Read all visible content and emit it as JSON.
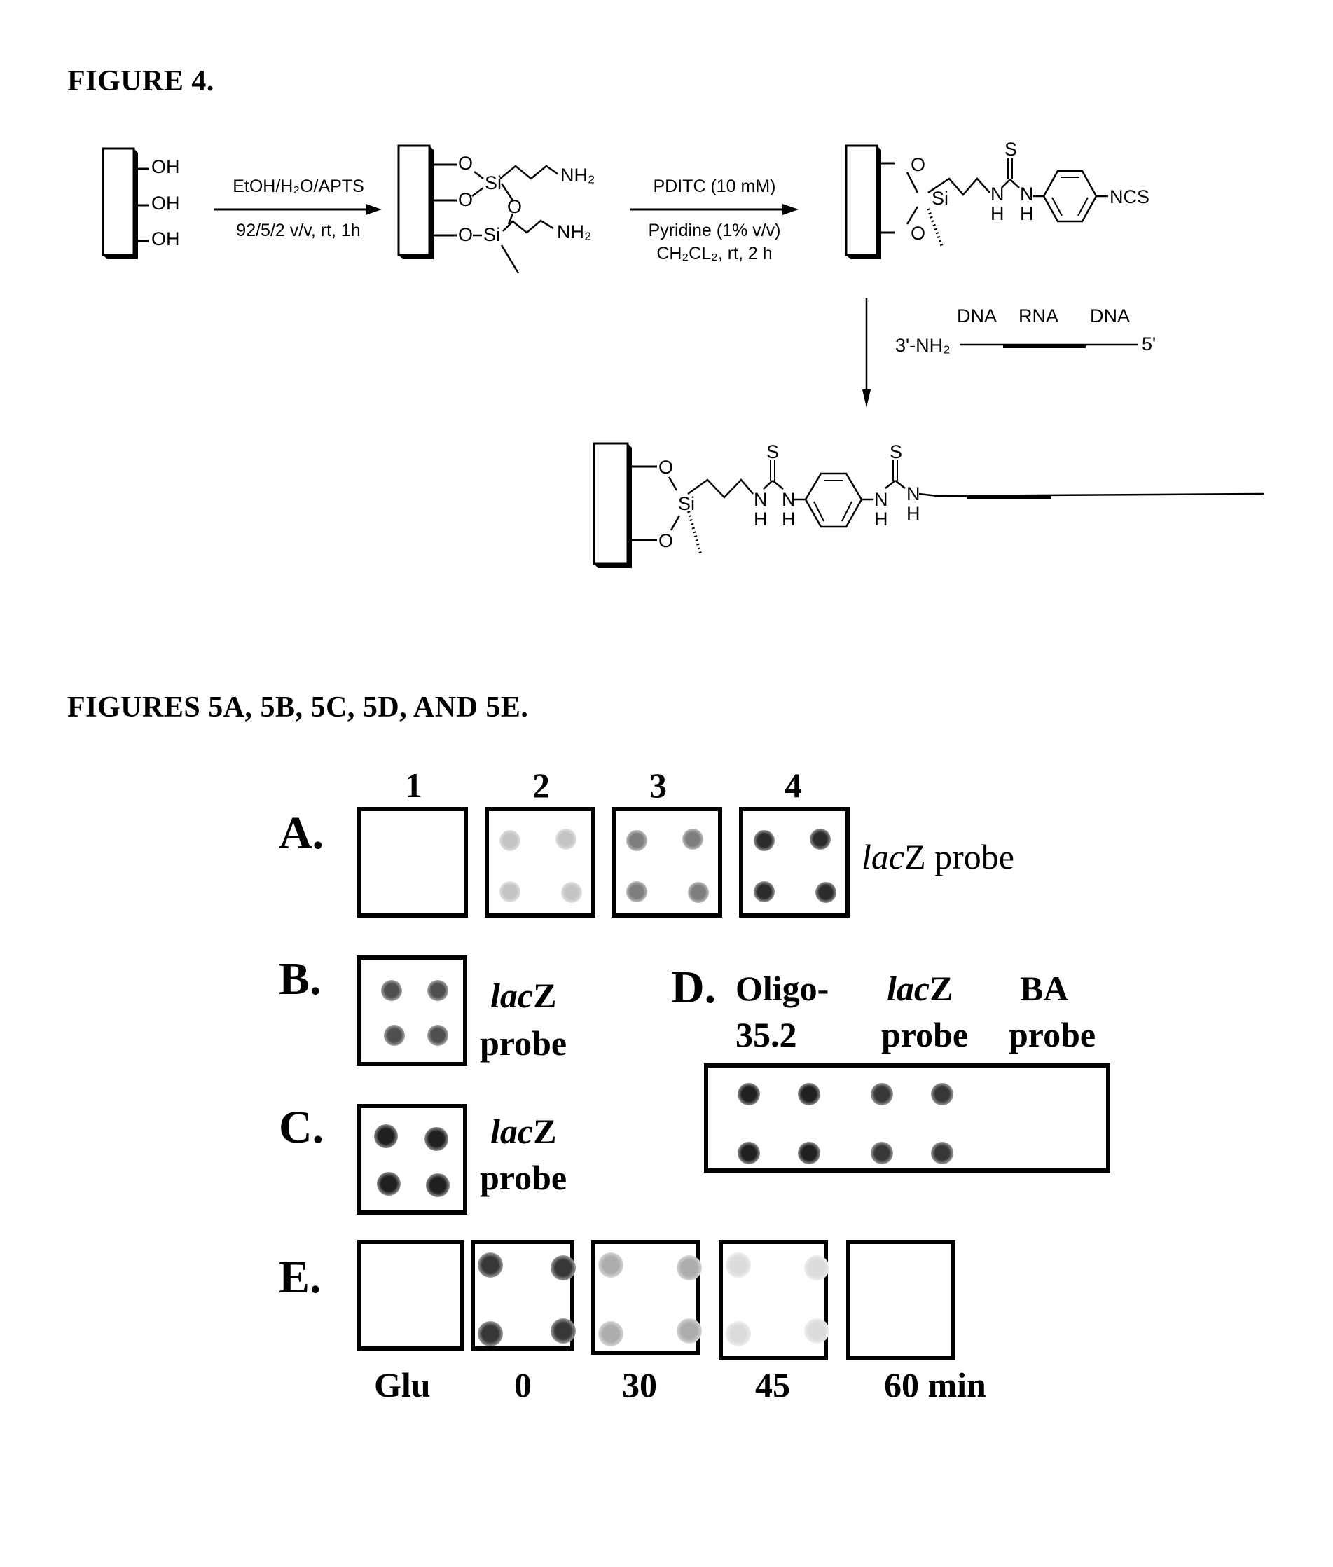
{
  "figure4": {
    "title": "FIGURE 4.",
    "step1": {
      "reagent_top": "EtOH/H₂O/APTS",
      "reagent_bottom": "92/5/2 v/v, rt, 1h",
      "start_groups": [
        "OH",
        "OH",
        "OH"
      ]
    },
    "intermediate1": {
      "atoms": {
        "o1": "O",
        "o2": "O",
        "o3": "O",
        "o_bridge": "O",
        "si1": "Si",
        "si2": "Si",
        "nh2_1": "NH₂",
        "nh2_2": "NH₂"
      }
    },
    "step2": {
      "reagent_top": "PDITC (10 mM)",
      "reagent_mid": "Pyridine (1% v/v)",
      "reagent_bottom": "CH₂CL₂, rt, 2 h"
    },
    "intermediate2": {
      "atoms": {
        "o1": "O",
        "o2": "O",
        "si": "Si",
        "s": "S",
        "n1": "N",
        "h1": "H",
        "n2": "N",
        "h2": "H",
        "ncs": "NCS"
      }
    },
    "step3": {
      "strand_labels": [
        "DNA",
        "RNA",
        "DNA"
      ],
      "end_3": "3'-NH₂",
      "end_5": "5'"
    },
    "product": {
      "atoms": {
        "o1": "O",
        "o2": "O",
        "si": "Si",
        "s1": "S",
        "s2": "S",
        "n1": "N",
        "h1": "H",
        "n2": "N",
        "h2": "H",
        "n3": "N",
        "h3": "H",
        "n4": "N",
        "h4": "H"
      }
    }
  },
  "figure5": {
    "title": "FIGURES 5A, 5B, 5C, 5D, AND 5E.",
    "panelA": {
      "letter": "A.",
      "columns": [
        "1",
        "2",
        "3",
        "4"
      ],
      "probe_italic": "lac",
      "probe_rest": "Z probe",
      "spot_intensity": [
        0.0,
        0.25,
        0.55,
        0.9
      ]
    },
    "panelB": {
      "letter": "B.",
      "probe_italic": "lac",
      "probe_z": "Z",
      "probe_word": "probe",
      "spot_intensity": 0.75
    },
    "panelC": {
      "letter": "C.",
      "probe_italic": "lac",
      "probe_z": "Z",
      "probe_word": "probe",
      "spot_intensity": 0.95
    },
    "panelD": {
      "letter": "D.",
      "headers": [
        {
          "line1": "Oligo-",
          "line2": "35.2",
          "italic_prefix": ""
        },
        {
          "line1": "Z",
          "line2": "probe",
          "italic_prefix": "lac"
        },
        {
          "line1": "BA",
          "line2": "probe",
          "italic_prefix": ""
        }
      ],
      "spot_intensity": [
        0.95,
        0.85,
        0.0
      ]
    },
    "panelE": {
      "letter": "E.",
      "labels": [
        "Glu",
        "0",
        "30",
        "45",
        "60 min"
      ],
      "spot_intensity": [
        0.0,
        0.85,
        0.35,
        0.15,
        0.0
      ]
    }
  }
}
